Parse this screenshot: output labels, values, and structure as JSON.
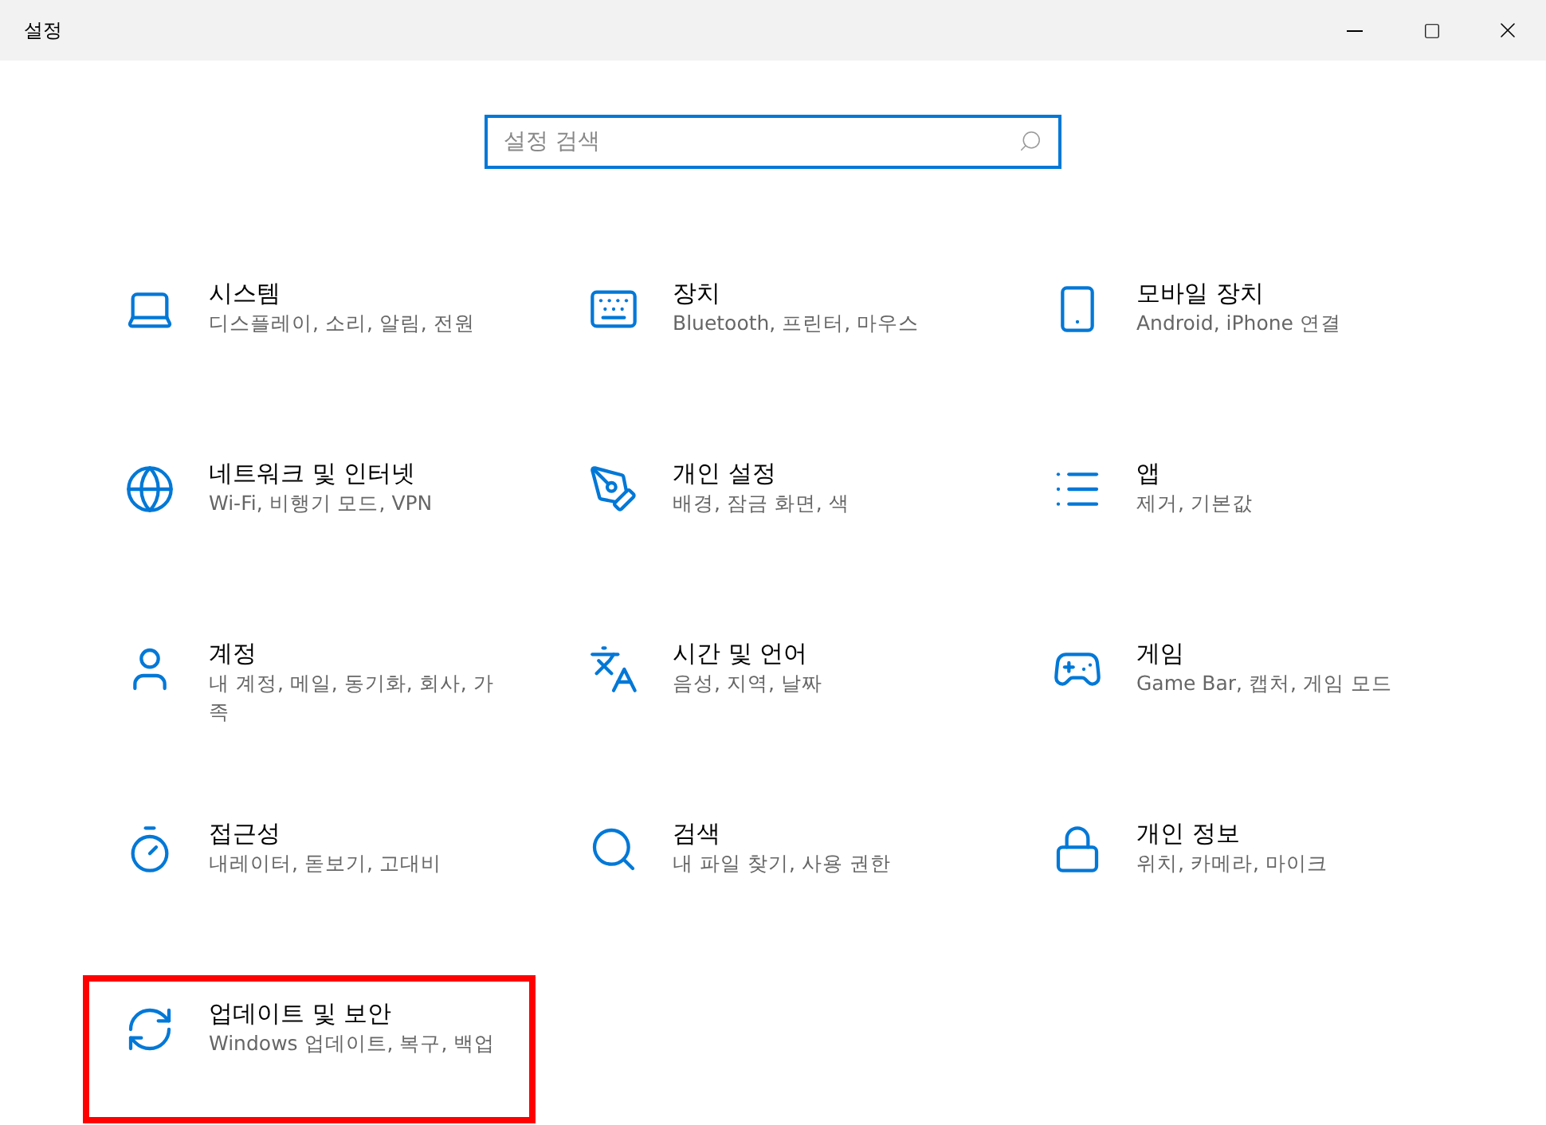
{
  "window": {
    "title": "설정"
  },
  "search": {
    "placeholder": "설정 검색"
  },
  "items": [
    {
      "title": "시스템",
      "description": "디스플레이, 소리, 알림, 전원",
      "highlighted": false
    },
    {
      "title": "장치",
      "description": "Bluetooth, 프린터, 마우스",
      "highlighted": false
    },
    {
      "title": "모바일 장치",
      "description": "Android, iPhone 연결",
      "highlighted": false
    },
    {
      "title": "네트워크 및 인터넷",
      "description": "Wi-Fi, 비행기 모드, VPN",
      "highlighted": false
    },
    {
      "title": "개인 설정",
      "description": "배경, 잠금 화면, 색",
      "highlighted": false
    },
    {
      "title": "앱",
      "description": "제거, 기본값",
      "highlighted": false
    },
    {
      "title": "계정",
      "description": "내 계정, 메일, 동기화, 회사, 가족",
      "highlighted": false
    },
    {
      "title": "시간 및 언어",
      "description": "음성, 지역, 날짜",
      "highlighted": false
    },
    {
      "title": "게임",
      "description": "Game Bar, 캡처, 게임 모드",
      "highlighted": false
    },
    {
      "title": "접근성",
      "description": "내레이터, 돋보기, 고대비",
      "highlighted": false
    },
    {
      "title": "검색",
      "description": "내 파일 찾기, 사용 권한",
      "highlighted": false
    },
    {
      "title": "개인 정보",
      "description": "위치, 카메라, 마이크",
      "highlighted": false
    },
    {
      "title": "업데이트 및 보안",
      "description": "Windows 업데이트, 복구, 백업",
      "highlighted": true
    }
  ]
}
